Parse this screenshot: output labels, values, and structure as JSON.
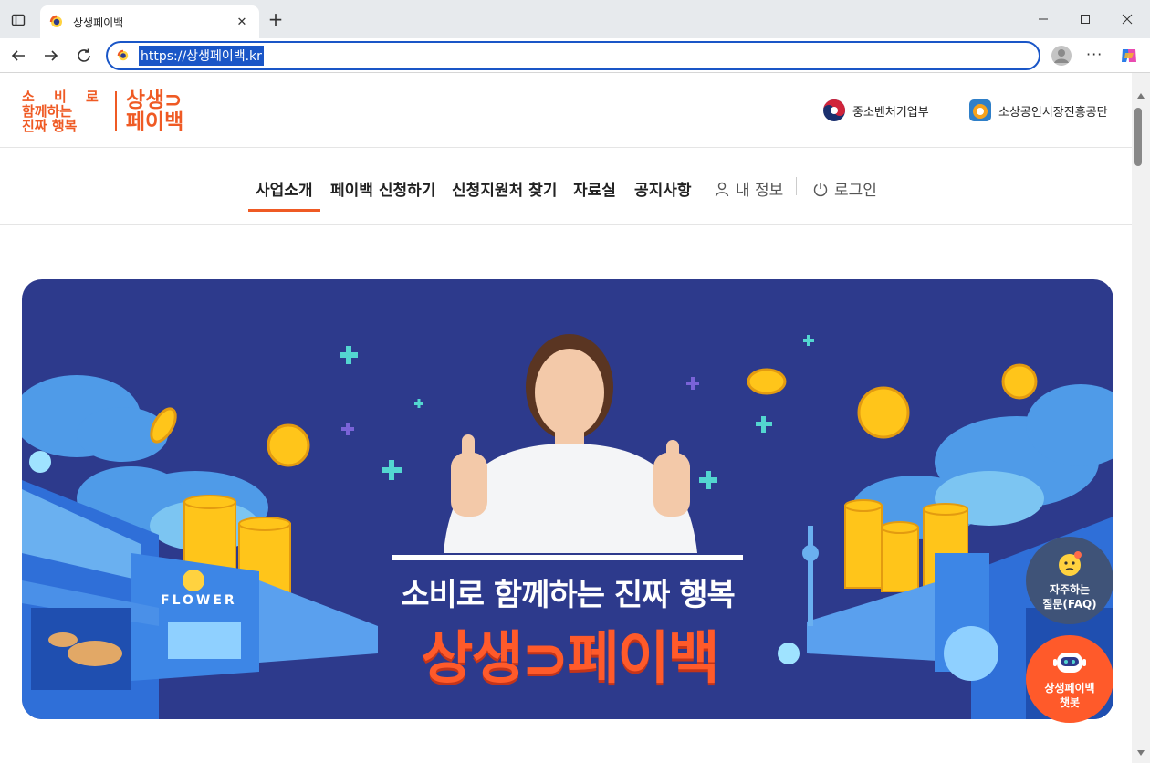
{
  "browser": {
    "tab_title": "상생페이백",
    "url": "https://상생페이백.kr",
    "icons": [
      "tab-actions-icon",
      "favicon",
      "close-icon",
      "new-tab-icon",
      "minimize-icon",
      "maximize-icon",
      "window-close-icon",
      "back-icon",
      "forward-icon",
      "reload-icon",
      "profile-icon",
      "more-icon",
      "copilot-icon"
    ]
  },
  "header": {
    "slogan_line1": "소 비 로",
    "slogan_line2": "함께하는",
    "slogan_line3": "진짜 행복",
    "brand_line1": "상생⊃",
    "brand_line2": "페이백",
    "org1": "중소벤처기업부",
    "org2": "소상공인시장진흥공단"
  },
  "nav": {
    "items": [
      "사업소개",
      "페이백 신청하기",
      "신청지원처 찾기",
      "자료실",
      "공지사항"
    ],
    "active": "사업소개",
    "my_info": "내 정보",
    "login": "로그인"
  },
  "banner": {
    "headline": "소비로 함께하는 진짜 행복",
    "brand": "상생⊃페이백",
    "shop_sign": "FLOWER"
  },
  "floating": {
    "faq_line1": "자주하는",
    "faq_line2": "질문(FAQ)",
    "chatbot_line1": "상생페이백",
    "chatbot_line2": "챗봇"
  },
  "colors": {
    "accent": "#ef5a24",
    "banner_bg": "#2d3a8c",
    "address_focus": "#1a56c7",
    "faq_bg": "#3f5378"
  }
}
